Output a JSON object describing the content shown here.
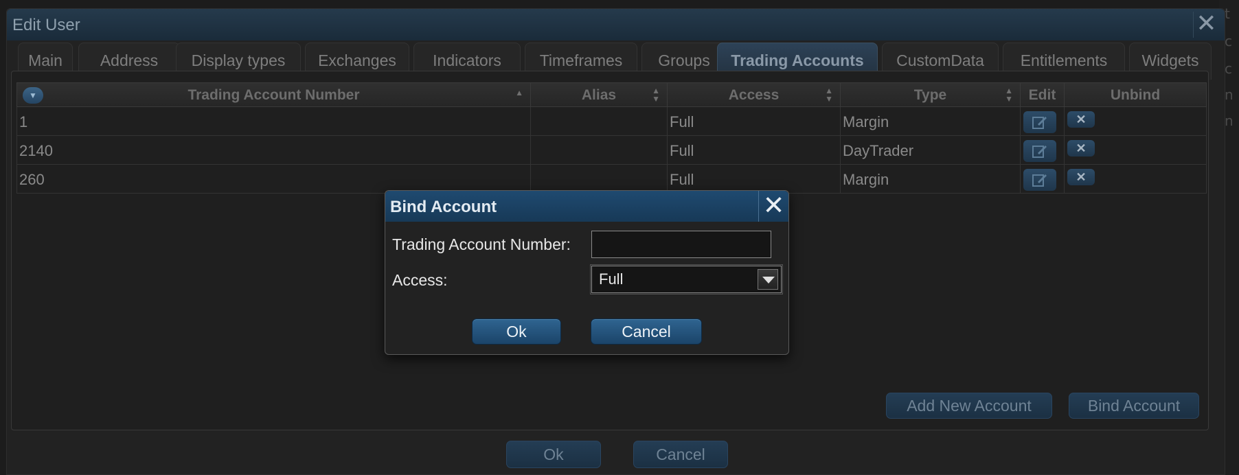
{
  "window": {
    "title": "Edit User",
    "close_glyph": "✕"
  },
  "tabs": [
    {
      "label": "Main"
    },
    {
      "label": "Address"
    },
    {
      "label": "Display types"
    },
    {
      "label": "Exchanges"
    },
    {
      "label": "Indicators"
    },
    {
      "label": "Timeframes"
    },
    {
      "label": "Groups"
    },
    {
      "label": "Trading Accounts",
      "active": true
    },
    {
      "label": "CustomData"
    },
    {
      "label": "Entitlements"
    },
    {
      "label": "Widgets"
    }
  ],
  "grid": {
    "columns": {
      "number": "Trading Account Number",
      "alias": "Alias",
      "access": "Access",
      "type": "Type",
      "edit": "Edit",
      "unbind": "Unbind"
    },
    "rows": [
      {
        "number": "1",
        "alias": "",
        "access": "Full",
        "type": "Margin"
      },
      {
        "number": "2140",
        "alias": "",
        "access": "Full",
        "type": "DayTrader"
      },
      {
        "number": "260",
        "alias": "",
        "access": "Full",
        "type": "Margin"
      }
    ]
  },
  "panel_buttons": {
    "add": "Add New Account",
    "bind": "Bind Account"
  },
  "footer": {
    "ok": "Ok",
    "cancel": "Cancel"
  },
  "dialog": {
    "title": "Bind Account",
    "close_glyph": "✕",
    "number_label": "Trading Account Number:",
    "number_value": "",
    "access_label": "Access:",
    "access_value": "Full",
    "ok": "Ok",
    "cancel": "Cancel"
  },
  "colors": {
    "accent": "#1f4a70",
    "background": "#1c1c1c"
  }
}
